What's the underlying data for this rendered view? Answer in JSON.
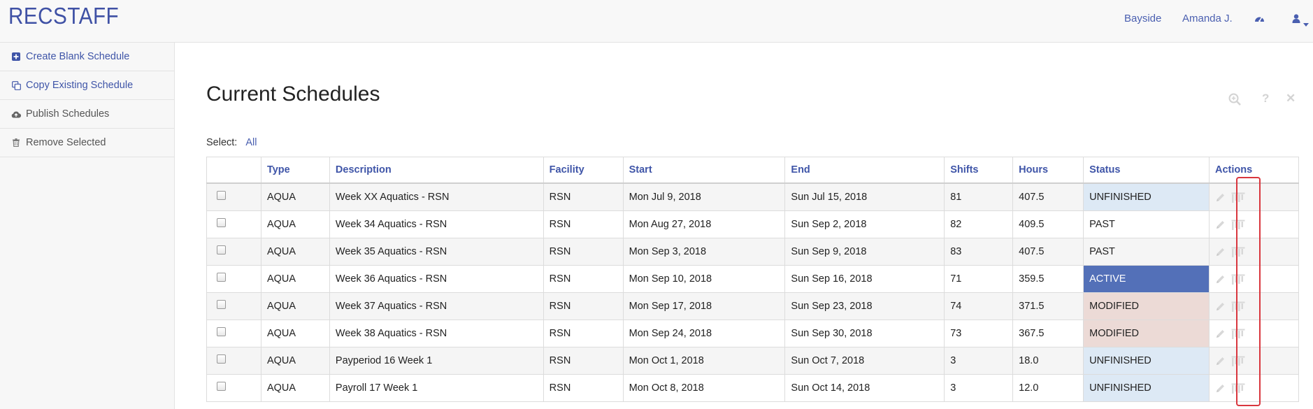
{
  "brand": "RECSTAFF",
  "header": {
    "location": "Bayside",
    "user": "Amanda J.",
    "icons": [
      "dashboard-icon",
      "user-icon",
      "caret-down-icon"
    ]
  },
  "sidebar": {
    "items": [
      {
        "label": "Create Blank Schedule",
        "icon": "plus-square-icon"
      },
      {
        "label": "Copy Existing Schedule",
        "icon": "copy-icon"
      },
      {
        "label": "Publish Schedules",
        "icon": "cloud-upload-icon"
      },
      {
        "label": "Remove Selected",
        "icon": "trash-icon"
      }
    ]
  },
  "main": {
    "title": "Current Schedules",
    "tools": [
      "zoom-icon",
      "help-icon",
      "close-icon"
    ],
    "help_glyph": "?",
    "close_glyph": "✕",
    "select_label": "Select:",
    "select_all": "All"
  },
  "table": {
    "headers": [
      "",
      "Type",
      "Description",
      "Facility",
      "Start",
      "End",
      "Shifts",
      "Hours",
      "Status",
      "Actions"
    ],
    "rows": [
      [
        "AQUA",
        "Week XX Aquatics - RSN",
        "RSN",
        "Mon Jul 9, 2018",
        "Sun Jul 15, 2018",
        "81",
        "407.5",
        "UNFINISHED"
      ],
      [
        "AQUA",
        "Week 34 Aquatics - RSN",
        "RSN",
        "Mon Aug 27, 2018",
        "Sun Sep 2, 2018",
        "82",
        "409.5",
        "PAST"
      ],
      [
        "AQUA",
        "Week 35 Aquatics - RSN",
        "RSN",
        "Mon Sep 3, 2018",
        "Sun Sep 9, 2018",
        "83",
        "407.5",
        "PAST"
      ],
      [
        "AQUA",
        "Week 36 Aquatics - RSN",
        "RSN",
        "Mon Sep 10, 2018",
        "Sun Sep 16, 2018",
        "71",
        "359.5",
        "ACTIVE"
      ],
      [
        "AQUA",
        "Week 37 Aquatics - RSN",
        "RSN",
        "Mon Sep 17, 2018",
        "Sun Sep 23, 2018",
        "74",
        "371.5",
        "MODIFIED"
      ],
      [
        "AQUA",
        "Week 38 Aquatics - RSN",
        "RSN",
        "Mon Sep 24, 2018",
        "Sun Sep 30, 2018",
        "73",
        "367.5",
        "MODIFIED"
      ],
      [
        "AQUA",
        "Payperiod 16 Week 1",
        "RSN",
        "Mon Oct 1, 2018",
        "Sun Oct 7, 2018",
        "3",
        "18.0",
        "UNFINISHED"
      ],
      [
        "AQUA",
        "Payroll 17 Week 1",
        "RSN",
        "Mon Oct 8, 2018",
        "Sun Oct 14, 2018",
        "3",
        "12.0",
        "UNFINISHED"
      ]
    ],
    "action_icons": [
      "edit-pencil-icon",
      "schedule-chart-icon"
    ]
  },
  "colors": {
    "brand": "#3f51a5",
    "link": "#4a5fb0",
    "active": "#5370b8",
    "unfinished": "#dde9f5",
    "modified": "#ecdad6",
    "highlight": "#d9363e"
  }
}
